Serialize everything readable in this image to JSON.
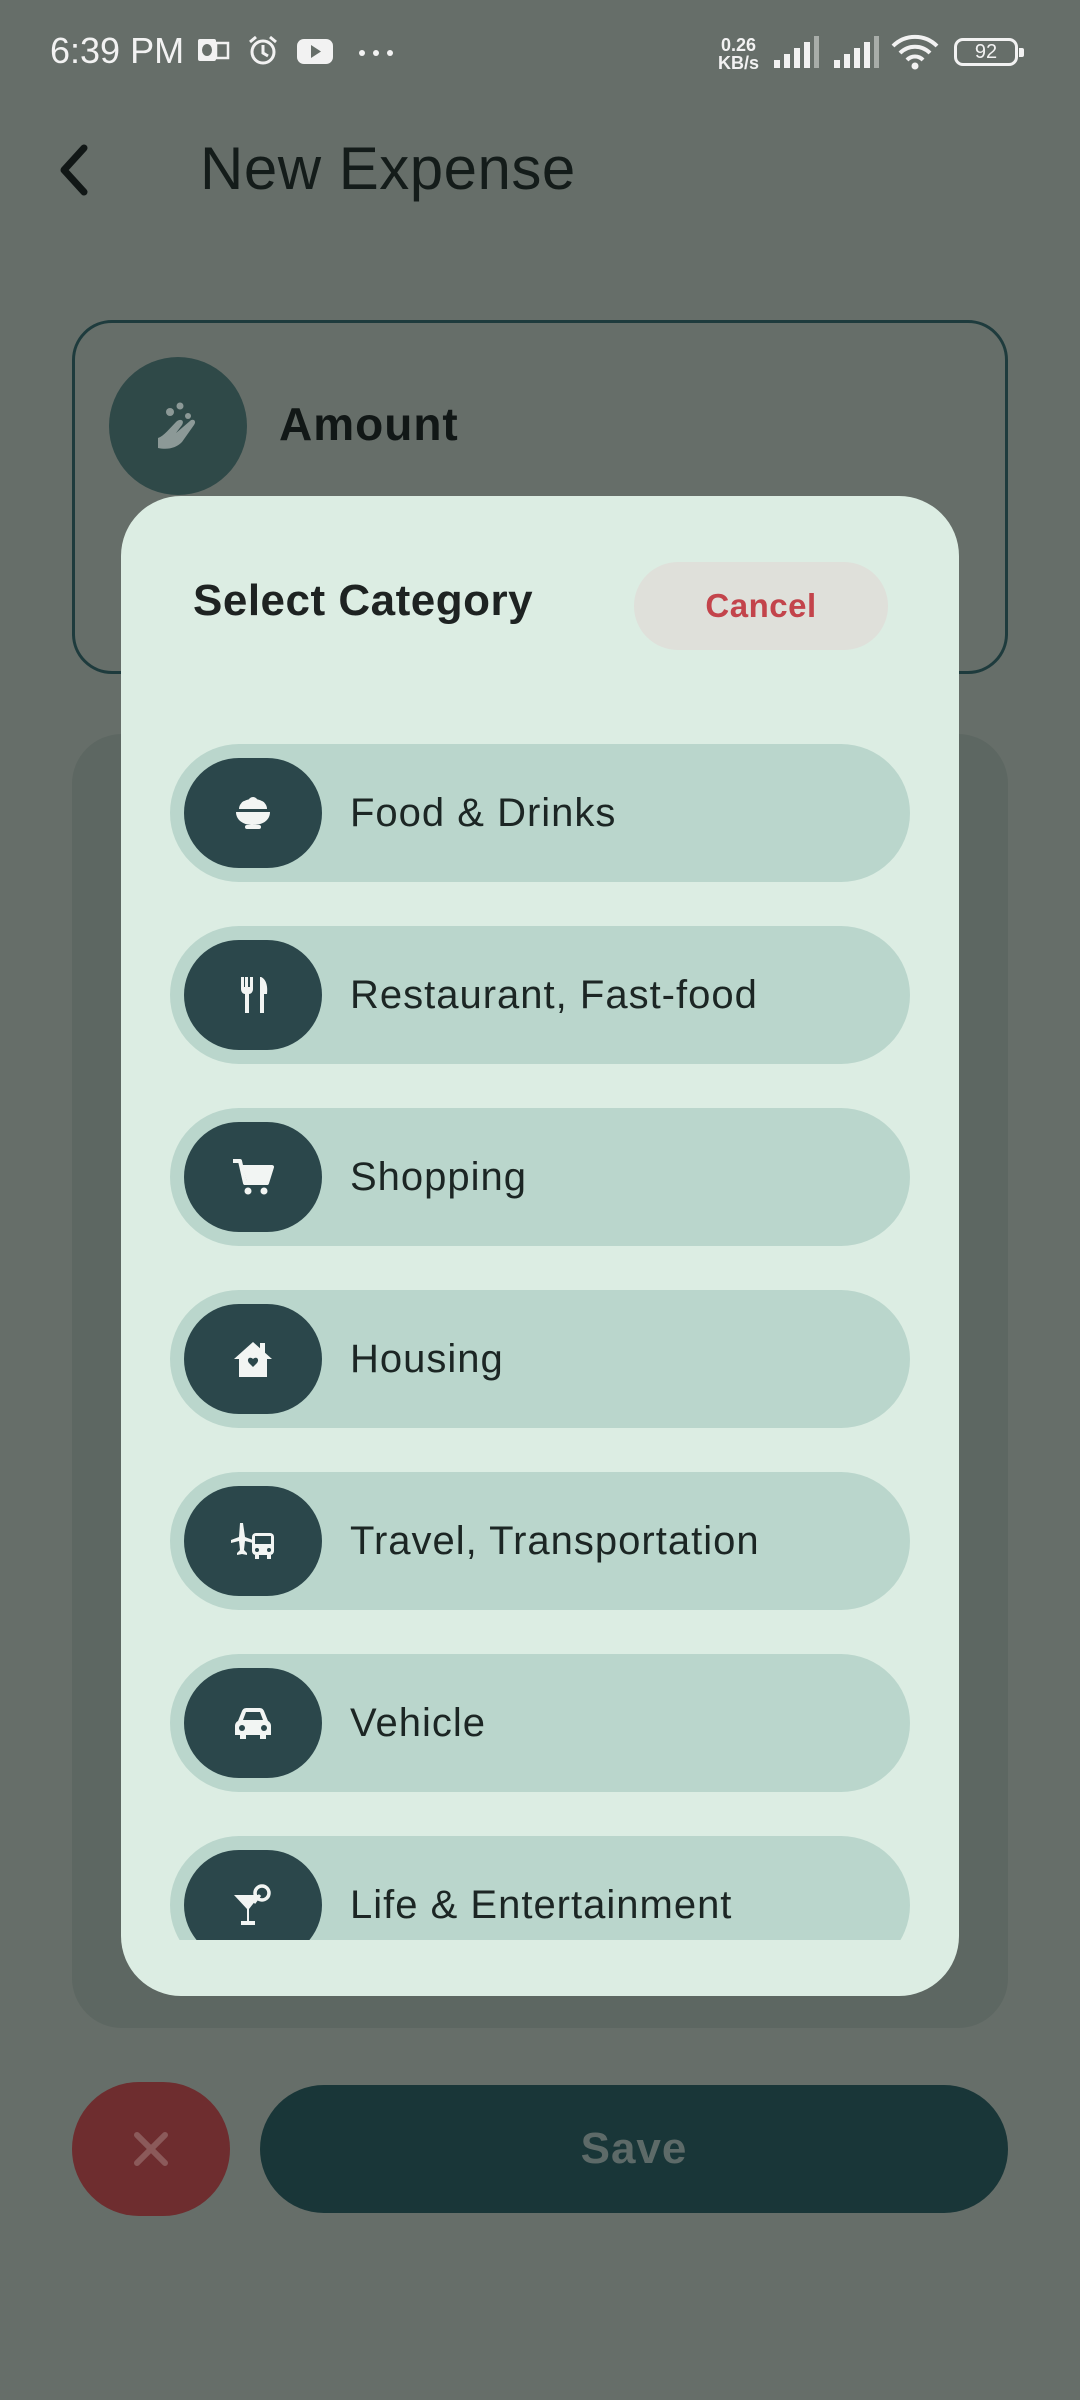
{
  "status_bar": {
    "time": "6:39 PM",
    "speed_value": "0.26",
    "speed_unit": "KB/s",
    "battery": "92",
    "icons": [
      "outlook-icon",
      "alarm-icon",
      "youtube-icon",
      "more-dots-icon",
      "signal-icon",
      "signal-icon",
      "wifi-icon",
      "battery-icon"
    ]
  },
  "header": {
    "title": "New Expense",
    "back_icon": "chevron-left-icon"
  },
  "form": {
    "amount_label": "Amount",
    "amount_icon": "coins-hand-icon",
    "save_label": "Save",
    "close_icon": "close-icon"
  },
  "dialog": {
    "title": "Select Category",
    "cancel_label": "Cancel",
    "categories": [
      {
        "label": "Food & Drinks",
        "icon": "food-bowl-icon"
      },
      {
        "label": "Restaurant, Fast-food",
        "icon": "fork-knife-icon"
      },
      {
        "label": "Shopping",
        "icon": "shopping-cart-icon"
      },
      {
        "label": "Housing",
        "icon": "house-icon"
      },
      {
        "label": "Travel, Transportation",
        "icon": "plane-bus-icon"
      },
      {
        "label": "Vehicle",
        "icon": "car-icon"
      },
      {
        "label": "Life & Entertainment",
        "icon": "cocktail-icon"
      }
    ]
  },
  "colors": {
    "scrim_background": "#666e69",
    "dialog_background": "#dcede3",
    "category_item": "#bad6cc",
    "icon_circle": "#2b474b",
    "cancel_text": "#c3444b",
    "save_button": "#193638",
    "close_button": "#6e2d2f"
  }
}
